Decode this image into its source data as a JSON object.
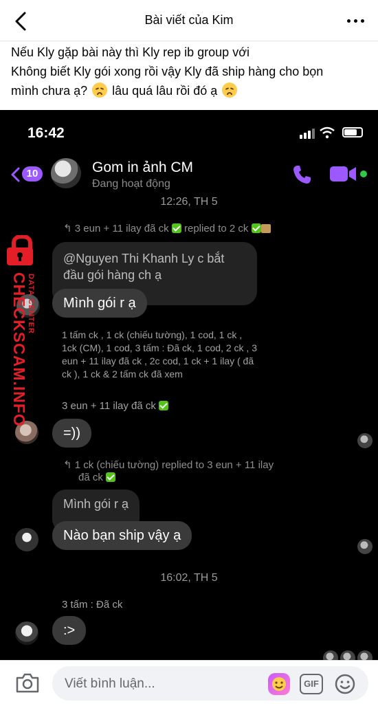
{
  "nav": {
    "title": "Bài viết của Kim"
  },
  "post": {
    "line1": "Nếu Kly gặp bài này thì Kly rep ib group với",
    "line2": "Không biết Kly gói xong rồi vậy Kly đã ship hàng cho bọn",
    "line3a": "mình chưa ạ?",
    "line3b": "lâu quá lâu rồi đó ạ"
  },
  "screenshot": {
    "status_time": "16:42",
    "chat_name": "Gom in ảnh CM",
    "chat_status": "Đang hoạt động",
    "back_badge_count": "10",
    "timestamp1": "12:26, TH 5",
    "reply1_meta": "3 eun + 11 ilay đã ck",
    "reply1_suffix": "replied to 2 ck",
    "quoted1": "@Nguyen Thi Khanh Ly c bắt đầu gói hàng ch ạ",
    "msg1": "Mình gói r ạ",
    "summary_line1": "1 tấm ck , 1 ck  (chiếu tường), 1 cod, 1 ck ,",
    "summary_line2": "1ck  (CM), 1 cod, 3 tấm : Đã ck, 1 cod, 2 ck , 3",
    "summary_line3": "eun + 11 ilay đã ck , 2c cod, 1 ck  + 1 ilay ( đã",
    "summary_line4": "ck ), 1 ck  & 2 tấm ck  đã xem",
    "label2": "3 eun + 11 ilay đã ck",
    "msg2": "=))",
    "reply2_meta": "1 ck  (chiếu tường) replied to 3 eun + 11 ilay",
    "reply2_meta2": "đã ck",
    "quoted2": "Mình gói r ạ",
    "msg3": "Nào bạn ship vậy ạ",
    "timestamp2": "16:02, TH 5",
    "label3": "3 tấm : Đã ck",
    "msg4": ":>",
    "watermark_main": "CHECKSCAM.INFO",
    "watermark_small": "DATA CENTER"
  },
  "comment": {
    "placeholder": "Viết bình luận..."
  },
  "colors": {
    "accent_purple": "#9b59ff",
    "watermark_red": "#e41e26",
    "online_green": "#30c94a"
  }
}
